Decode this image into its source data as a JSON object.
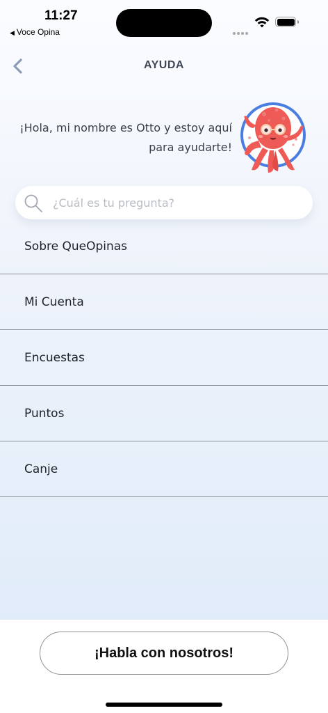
{
  "status_bar": {
    "time": "11:27",
    "back_app": "Voce Opina",
    "back_arrow": "◀",
    "icons": [
      "cellular-signal-icon",
      "wifi-icon",
      "battery-icon"
    ]
  },
  "header": {
    "title": "AYUDA",
    "back_icon": "chevron-left-icon"
  },
  "greeting": {
    "text": "¡Hola, mi nombre es Otto y estoy aquí para ayudarte!",
    "mascot": "octopus-mascot"
  },
  "search": {
    "placeholder": "¿Cuál es tu pregunta?",
    "value": "",
    "icon": "search-icon"
  },
  "help_list": {
    "items": [
      {
        "label": "Sobre QueOpinas"
      },
      {
        "label": "Mi Cuenta"
      },
      {
        "label": "Encuestas"
      },
      {
        "label": "Puntos"
      },
      {
        "label": "Canje"
      }
    ]
  },
  "footer": {
    "contact_label": "¡Habla con nosotros!"
  },
  "colors": {
    "accent_blue": "#4a7ee0",
    "mascot_red": "#ee5a56",
    "title_gray": "#3f4757",
    "background_top": "#fbfcff",
    "background_bottom": "#e1ecfa"
  }
}
